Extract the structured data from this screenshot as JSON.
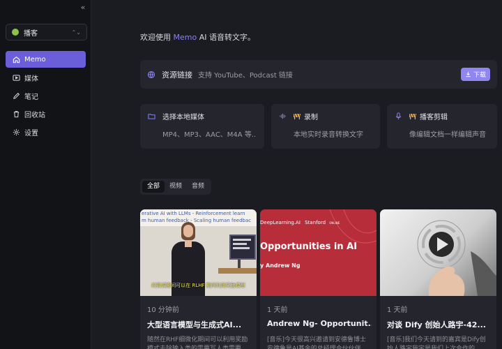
{
  "sidebar": {
    "collapse_icon": "double-chevron-left-icon",
    "workspace": {
      "label": "播客",
      "dot_color": "#8bc34a"
    },
    "items": [
      {
        "label": "Memo",
        "icon": "home-icon",
        "active": true
      },
      {
        "label": "媒体",
        "icon": "video-icon",
        "active": false
      },
      {
        "label": "笔记",
        "icon": "pencil-icon",
        "active": false
      },
      {
        "label": "回收站",
        "icon": "trash-icon",
        "active": false
      },
      {
        "label": "设置",
        "icon": "gear-icon",
        "active": false
      }
    ]
  },
  "welcome": {
    "prefix": "欢迎使用",
    "brand": "Memo",
    "suffix": "AI 语音转文字。"
  },
  "resource": {
    "title": "资源链接",
    "hint": "支持 YouTube、Podcast 链接",
    "download_label": "下载"
  },
  "tools": [
    {
      "title": "选择本地媒体",
      "sub": "MP4、MP3、AAC、M4A 等..."
    },
    {
      "title": "录制",
      "sub": "本地实时录音转换文字"
    },
    {
      "title": "播客剪辑",
      "sub": "像编辑文档一样编辑声音"
    }
  ],
  "filter_tabs": [
    {
      "label": "全部",
      "active": true
    },
    {
      "label": "视频",
      "active": false
    },
    {
      "label": "音频",
      "active": false
    }
  ],
  "cards": [
    {
      "time": "10 分钟前",
      "title": "大型语言模型与生成式AI...",
      "desc": "随然在RHF细微化期间可以利用奖励模式去除输入类的需要写人类需要",
      "thumb_header": "erative AI with LLMs - Reinforcement learn",
      "thumb_header2": "m human feedback - Scaling human feedbac",
      "thumb_caption": "的微调期间可以在 RLHF 期间利用奖励模型"
    },
    {
      "time": "1 天前",
      "title": "Andrew Ng- Opportunit...",
      "desc": "[音乐]今天很高兴邀请到安德鲁博士安德鲁是AI基金的总经理合伙伙伴",
      "thumb_brand": "DeepLearning.AI",
      "thumb_brand2": "Stanford",
      "thumb_online": "ONLINE",
      "thumb_title": "Opportunities in AI",
      "thumb_author": "y Andrew Ng"
    },
    {
      "time": "1 天前",
      "title": "对谈 Dify 创始人路宇-42...",
      "desc": "[音乐]我们今天请到的嘉宾是Dify创始人路宇我宇是我们上次合作的"
    }
  ]
}
